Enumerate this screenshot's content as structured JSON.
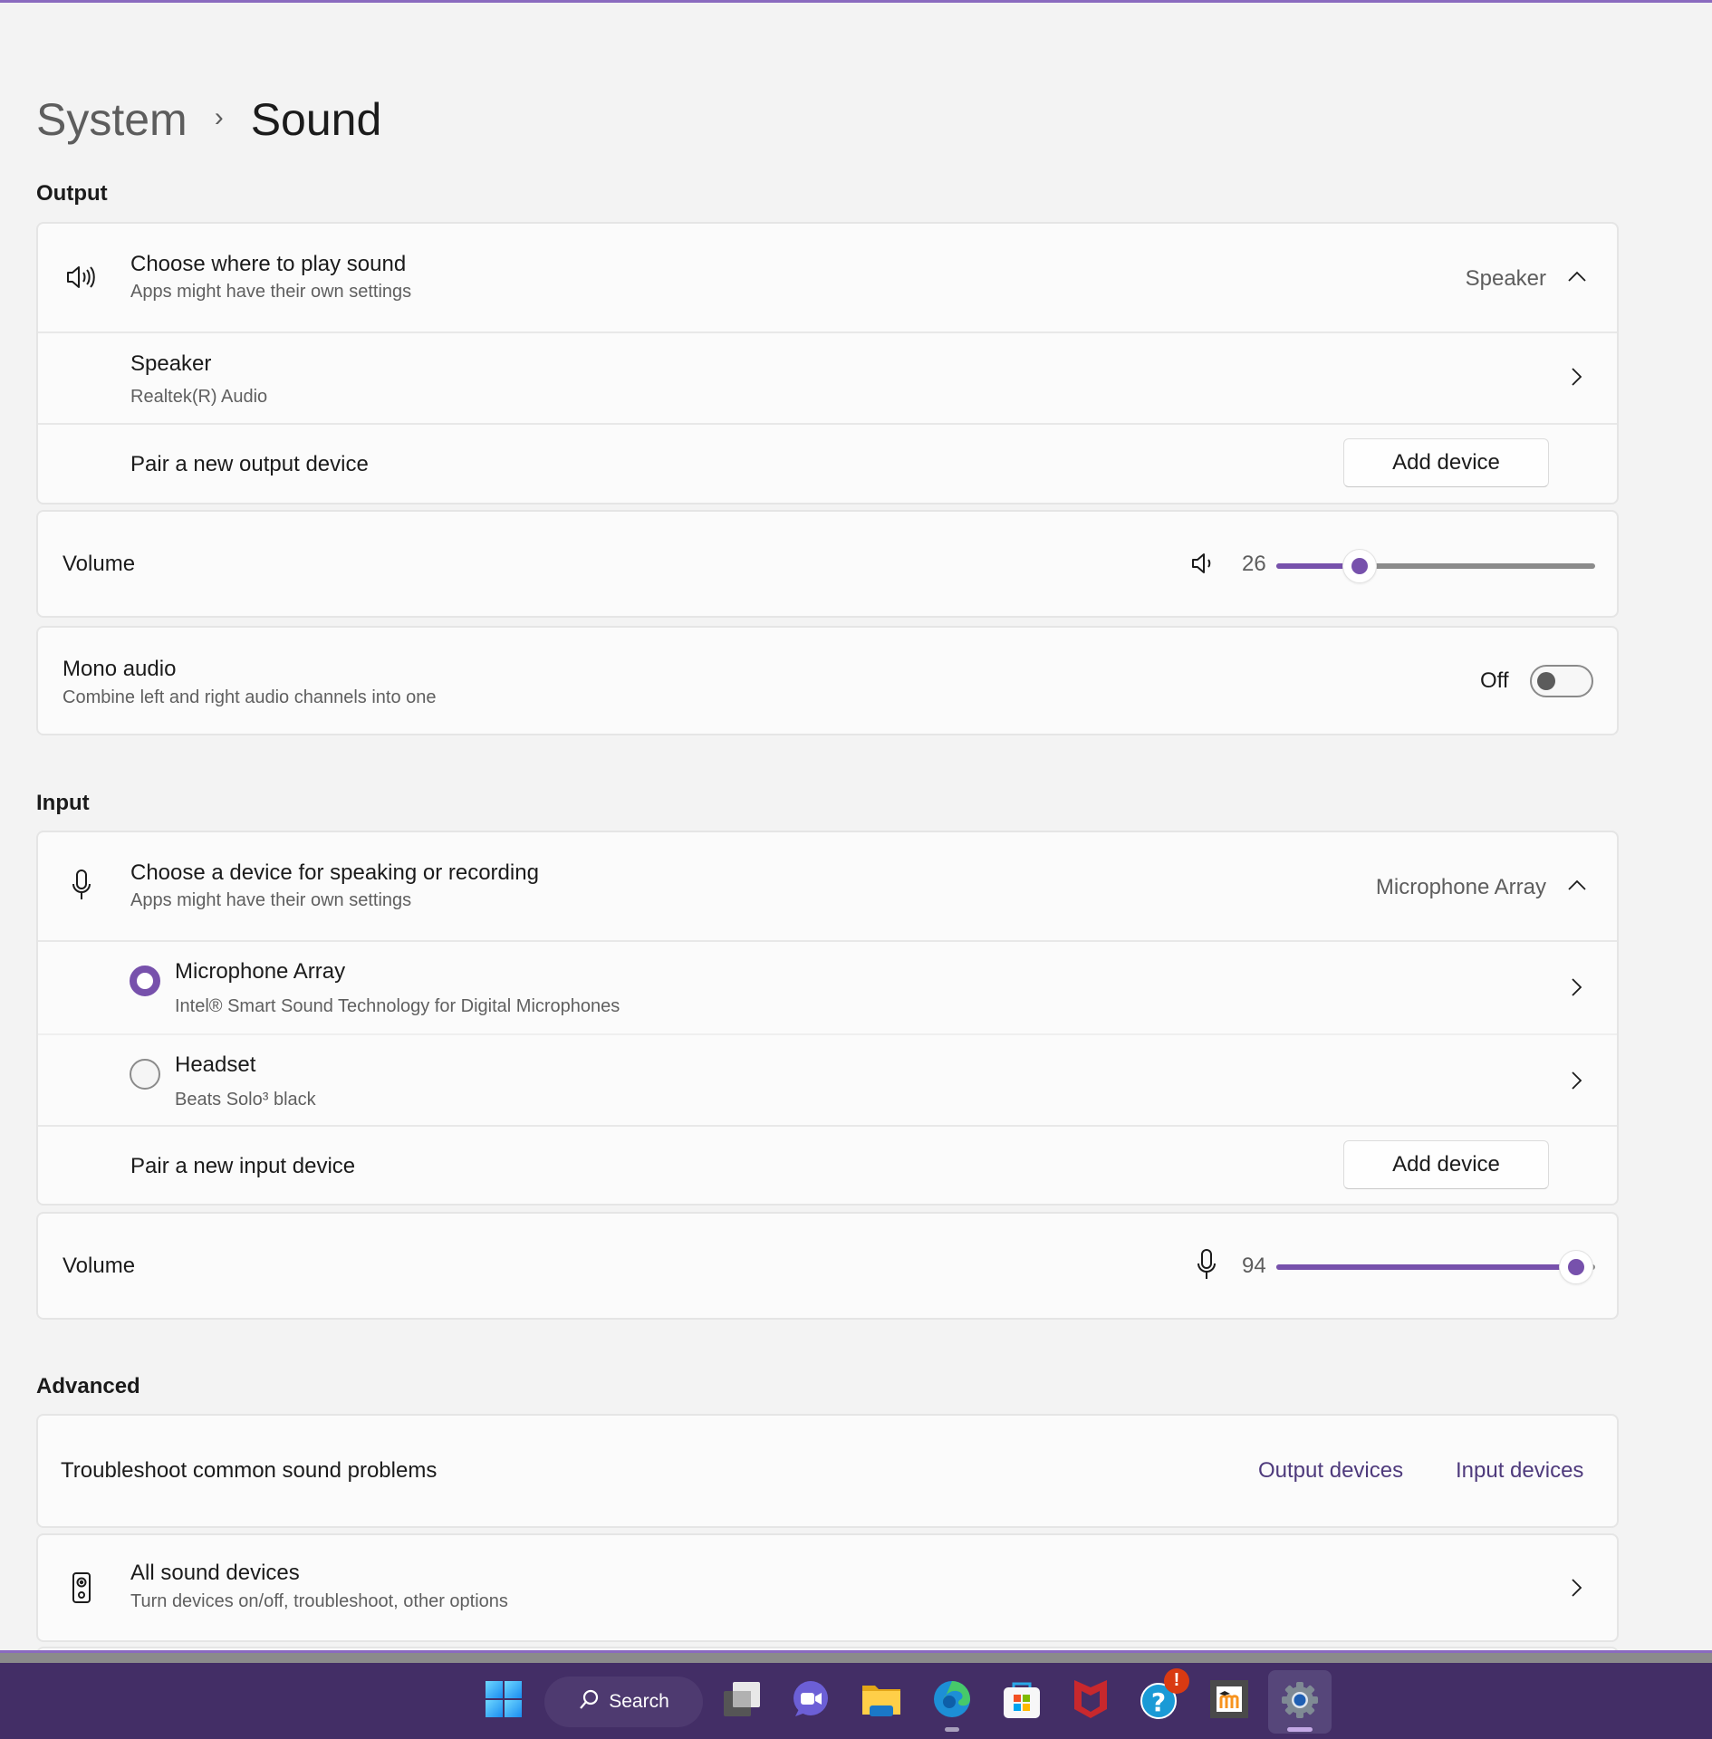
{
  "breadcrumb": {
    "parent": "System",
    "separator": "›",
    "current": "Sound"
  },
  "sections": {
    "output": "Output",
    "input": "Input",
    "advanced": "Advanced"
  },
  "output": {
    "choose": {
      "title": "Choose where to play sound",
      "subtitle": "Apps might have their own settings",
      "selected": "Speaker",
      "icon": "speaker-volume-icon",
      "expanded": true
    },
    "devices": [
      {
        "name": "Speaker",
        "detail": "Realtek(R) Audio"
      }
    ],
    "pair": {
      "label": "Pair a new output device",
      "button": "Add device"
    },
    "volume": {
      "label": "Volume",
      "value": "26",
      "percent": 26,
      "icon": "speaker-icon"
    },
    "mono": {
      "title": "Mono audio",
      "subtitle": "Combine left and right audio channels into one",
      "state_label": "Off",
      "enabled": false
    }
  },
  "input": {
    "choose": {
      "title": "Choose a device for speaking or recording",
      "subtitle": "Apps might have their own settings",
      "selected": "Microphone Array",
      "icon": "microphone-icon",
      "expanded": true
    },
    "devices": [
      {
        "name": "Microphone Array",
        "detail": "Intel® Smart Sound Technology for Digital Microphones",
        "selected": true
      },
      {
        "name": "Headset",
        "detail": "Beats Solo³ black",
        "selected": false
      }
    ],
    "pair": {
      "label": "Pair a new input device",
      "button": "Add device"
    },
    "volume": {
      "label": "Volume",
      "value": "94",
      "percent": 94,
      "icon": "microphone-icon"
    }
  },
  "advanced": {
    "troubleshoot": {
      "title": "Troubleshoot common sound problems",
      "links": [
        "Output devices",
        "Input devices"
      ]
    },
    "all_devices": {
      "title": "All sound devices",
      "subtitle": "Turn devices on/off, troubleshoot, other options",
      "icon": "speaker-device-icon"
    }
  },
  "colors": {
    "accent": "#7751ac",
    "link": "#4e3a7c",
    "taskbar": "#432e66"
  },
  "taskbar": {
    "search_label": "Search",
    "items": [
      {
        "name": "start",
        "icon": "windows-start-icon"
      },
      {
        "name": "task-view",
        "icon": "task-view-icon"
      },
      {
        "name": "teams-chat",
        "icon": "teams-chat-icon"
      },
      {
        "name": "file-explorer",
        "icon": "folder-icon"
      },
      {
        "name": "edge",
        "icon": "edge-browser-icon",
        "running": true
      },
      {
        "name": "microsoft-store",
        "icon": "store-icon"
      },
      {
        "name": "mcafee",
        "icon": "mcafee-shield-icon"
      },
      {
        "name": "get-help",
        "icon": "help-icon",
        "badge": "!"
      },
      {
        "name": "moodle",
        "icon": "moodle-icon"
      },
      {
        "name": "settings",
        "icon": "settings-gear-icon",
        "active": true
      }
    ]
  }
}
